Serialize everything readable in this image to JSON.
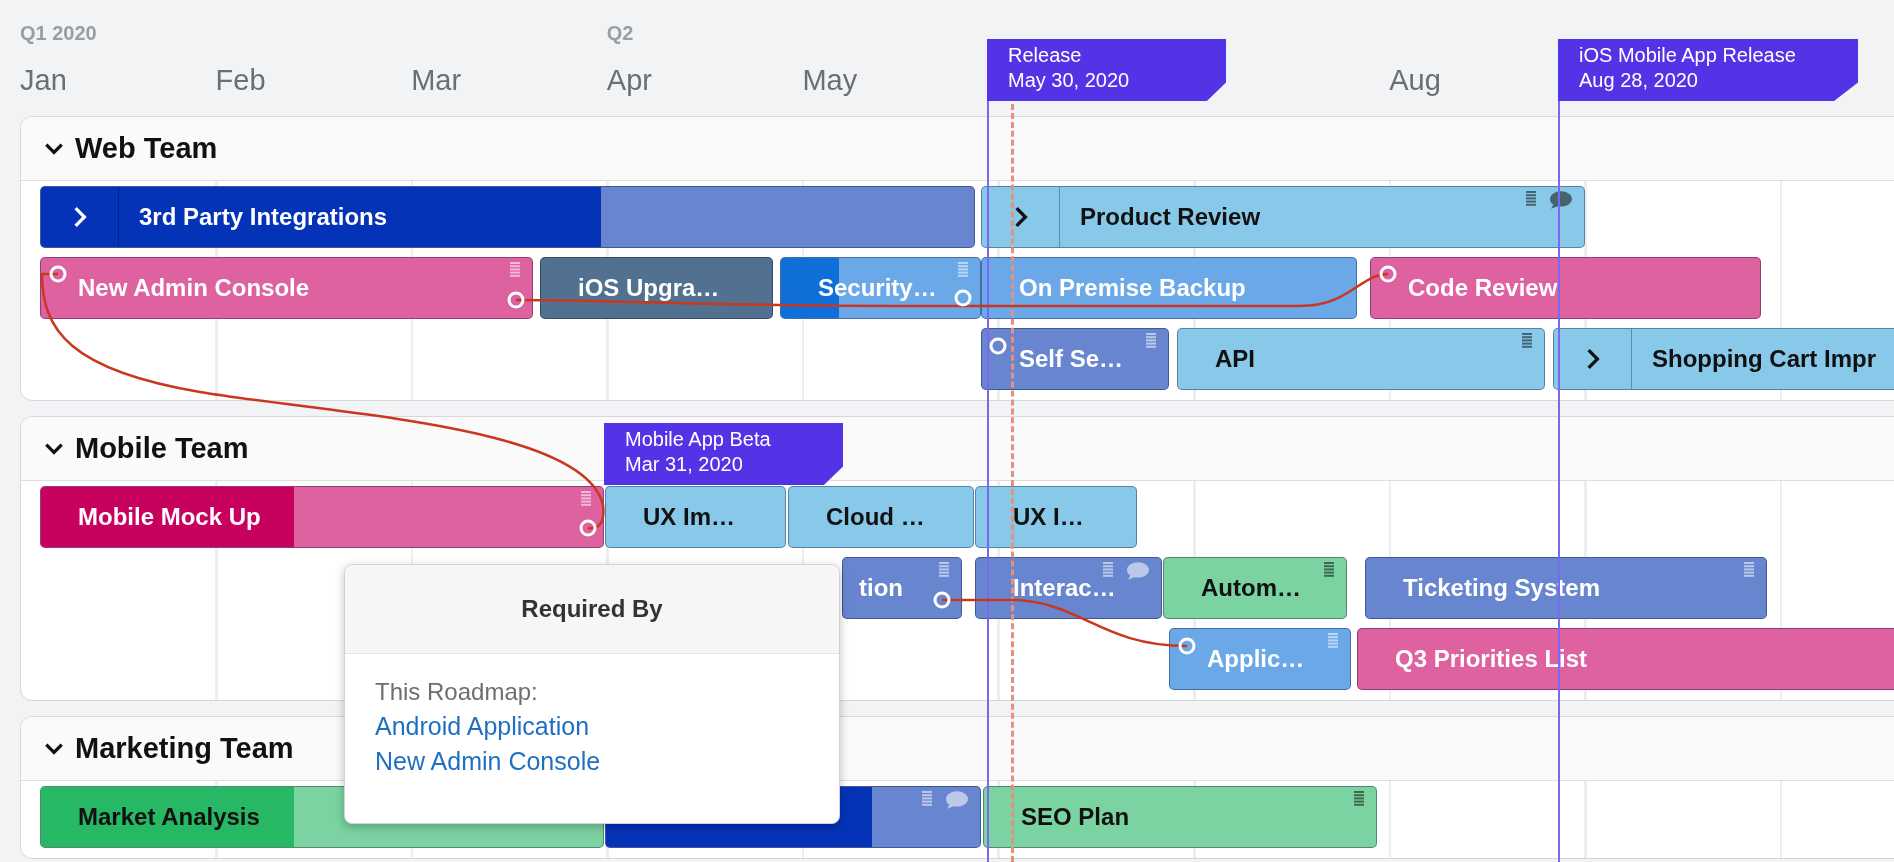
{
  "timeline": {
    "quarters": [
      "Q1 2020",
      "Q2"
    ],
    "months": [
      "Jan",
      "Feb",
      "Mar",
      "Apr",
      "May",
      "Aug"
    ]
  },
  "teams": [
    {
      "name": "Web Team",
      "expanded": true,
      "lanes": [
        [
          {
            "label": "3rd Party Integrations",
            "color": "#6886cf",
            "progress": {
              "level": 0.6,
              "color": "#0433b8"
            },
            "light_text": true,
            "expandable": true
          },
          {
            "label": "Product Review",
            "color": "#88c8e9",
            "light_text": false,
            "expandable": true,
            "notes": true,
            "comments": true
          }
        ],
        [
          {
            "label": "New Admin Console",
            "color": "#de62a0",
            "light_text": true,
            "notes": true
          },
          {
            "label": "iOS Upgra…",
            "color": "#52708f",
            "light_text": true
          },
          {
            "label": "Security…",
            "color": "#6aa8e8",
            "progress": {
              "level": 0.29,
              "color": "#0f6fd8"
            },
            "light_text": true,
            "notes": true
          },
          {
            "label": "On Premise Backup",
            "color": "#6aa8e8",
            "light_text": true
          },
          {
            "label": "Code Review",
            "color": "#de62a0",
            "light_text": true
          }
        ],
        [
          {
            "label": "Self Se…",
            "color": "#6886cf",
            "light_text": true,
            "notes": true
          },
          {
            "label": "API",
            "color": "#88c8e9",
            "light_text": false,
            "notes": true
          },
          {
            "label": "Shopping Cart Impr",
            "color": "#88c8e9",
            "light_text": false,
            "expandable": true
          }
        ]
      ]
    },
    {
      "name": "Mobile Team",
      "expanded": true,
      "lanes": [
        [
          {
            "label": "Mobile Mock Up",
            "color": "#de62a0",
            "progress": {
              "level": 0.45,
              "color": "#c8005e"
            },
            "light_text": true,
            "notes": true
          },
          {
            "label": "UX Im…",
            "color": "#88c8e9",
            "light_text": false
          },
          {
            "label": "Cloud …",
            "color": "#88c8e9",
            "light_text": false
          },
          {
            "label": "UX I…",
            "color": "#88c8e9",
            "light_text": false
          }
        ],
        [
          {
            "label": "tion",
            "color": "#6886cf",
            "light_text": true,
            "notes": true
          },
          {
            "label": "Interac…",
            "color": "#6886cf",
            "light_text": true,
            "notes": true,
            "comments": true
          },
          {
            "label": "Autom…",
            "color": "#7ad3a0",
            "light_text": false,
            "notes": true
          },
          {
            "label": "Ticketing System",
            "color": "#6886cf",
            "light_text": true,
            "notes": true
          }
        ],
        [
          {
            "label": "Applic…",
            "color": "#6aa8e8",
            "light_text": true,
            "notes": true
          },
          {
            "label": "Q3 Priorities List",
            "color": "#de62a0",
            "light_text": true
          }
        ]
      ]
    },
    {
      "name": "Marketing Team",
      "expanded": true,
      "lanes": [
        [
          {
            "label": "Market Analysis",
            "color": "#7ad3a0",
            "progress": {
              "level": 0.45,
              "color": "#26b864"
            },
            "light_text": false
          },
          {
            "color": "#6886cf",
            "progress": {
              "level": 0.71,
              "color": "#0433b8"
            },
            "light_text": true,
            "notes": true,
            "comments": true
          },
          {
            "label": "SEO Plan",
            "color": "#7ad3a0",
            "light_text": false,
            "notes": true
          }
        ]
      ]
    }
  ],
  "milestones": [
    {
      "title": "Release",
      "date": "May 30, 2020"
    },
    {
      "title": "iOS Mobile App Release",
      "date": "Aug 28, 2020"
    },
    {
      "title": "Mobile App Beta",
      "date": "Mar 31, 2020"
    }
  ],
  "tooltip": {
    "title": "Required By",
    "section": "This Roadmap:",
    "links": [
      "Android Application",
      "New Admin Console"
    ]
  }
}
